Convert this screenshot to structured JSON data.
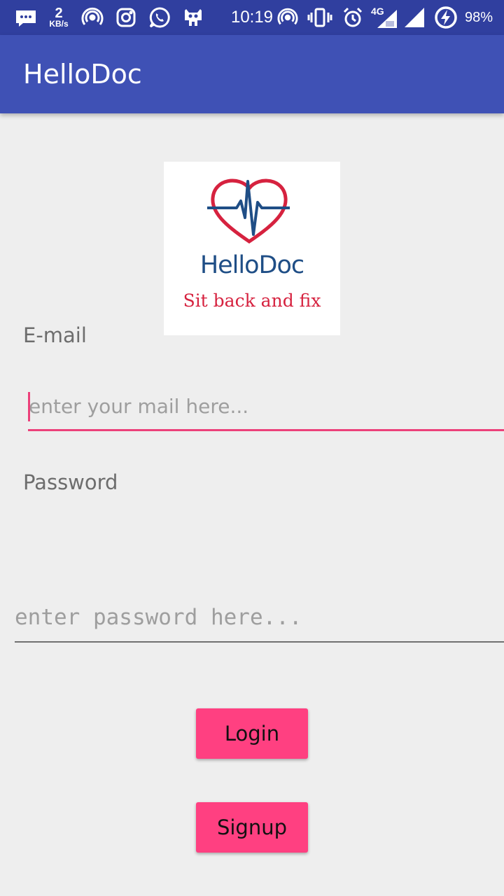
{
  "status_bar": {
    "net_speed_value": "2",
    "net_speed_unit": "KB/s",
    "time": "10:19",
    "network_type": "4G",
    "battery": "98%"
  },
  "app_bar": {
    "title": "HelloDoc"
  },
  "logo": {
    "name": "HelloDoc",
    "tagline": "Sit back and fix"
  },
  "form": {
    "email_label": "E-mail",
    "email_placeholder": "enter your mail here...",
    "password_label": "Password",
    "password_placeholder": "enter password here..."
  },
  "buttons": {
    "login": "Login",
    "signup": "Signup"
  },
  "colors": {
    "status_bar": "#303f9f",
    "app_bar": "#3f51b5",
    "accent": "#ff4081",
    "focus_line": "#ec407a"
  }
}
